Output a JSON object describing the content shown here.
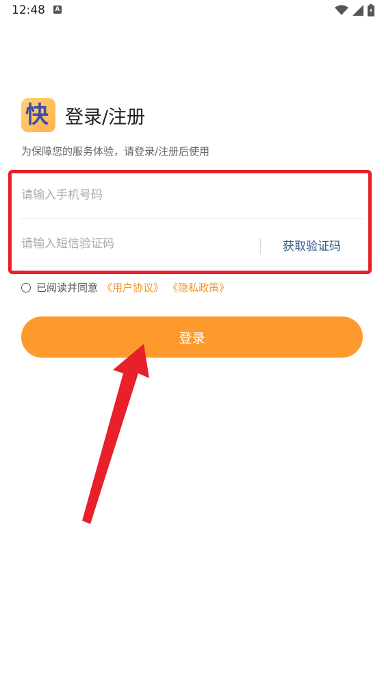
{
  "status_bar": {
    "time": "12:48",
    "notification_icon": "a-icon",
    "icons": [
      "wifi-icon",
      "signal-icon",
      "battery-icon"
    ]
  },
  "header": {
    "logo_char": "快",
    "title": "登录/注册",
    "subtitle": "为保障您的服务体验，请登录/注册后使用"
  },
  "form": {
    "phone_placeholder": "请输入手机号码",
    "code_placeholder": "请输入短信验证码",
    "get_code_label": "获取验证码"
  },
  "agreement": {
    "text": "已阅读并同意",
    "user_agreement": "《用户协议》",
    "privacy_policy": "《隐私政策》"
  },
  "login_button_label": "登录",
  "colors": {
    "accent": "#fe9a2c",
    "link": "#f4941d",
    "highlight": "#e8202a",
    "code_link": "#3a5a8c"
  }
}
